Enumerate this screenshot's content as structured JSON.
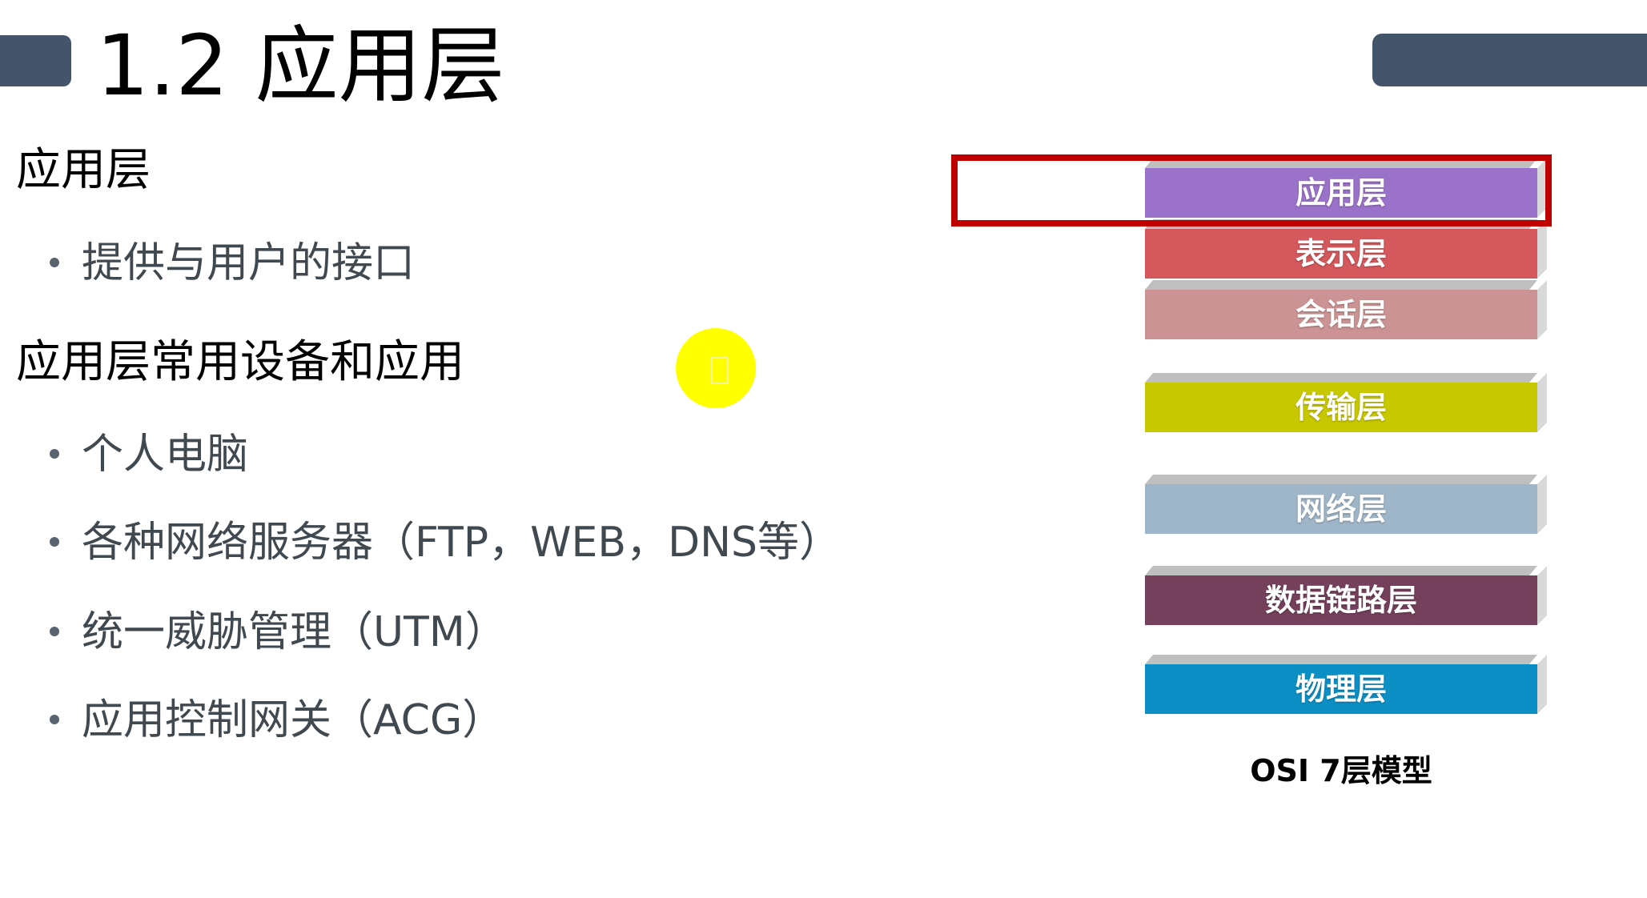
{
  "slide": {
    "title": "1.2 应用层",
    "section1": {
      "heading": "应用层",
      "bullets": [
        "提供与用户的接口"
      ]
    },
    "section2": {
      "heading": "应用层常用设备和应用",
      "bullets": [
        "个人电脑",
        "各种网络服务器（FTP，WEB，DNS等）",
        "统一威胁管理（UTM）",
        "应用控制网关（ACG）"
      ]
    }
  },
  "osi_model": {
    "caption": "OSI 7层模型",
    "highlighted_layer": "应用层",
    "highlight_color": "#c00000",
    "layers": [
      {
        "label": "应用层",
        "color": "#9b72c9"
      },
      {
        "label": "表示层",
        "color": "#d4585c"
      },
      {
        "label": "会话层",
        "color": "#cc9394"
      },
      {
        "label": "传输层",
        "color": "#c8c800"
      },
      {
        "label": "网络层",
        "color": "#9fb5c8"
      },
      {
        "label": "数据链路层",
        "color": "#74405c"
      },
      {
        "label": "物理层",
        "color": "#0c8fc4"
      }
    ]
  },
  "cursor": {
    "icon": "pointer-highlight-icon",
    "color": "#ffff00"
  },
  "theme": {
    "title_bar_color": "#44546a",
    "bullet_text_color": "#404850"
  }
}
